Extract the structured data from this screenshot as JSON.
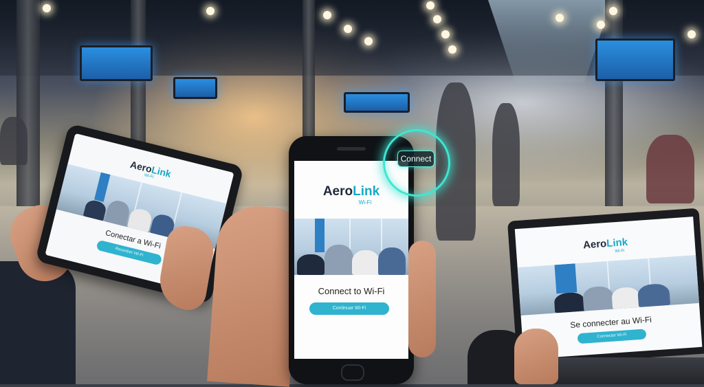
{
  "scene": {
    "setting": "airport-terminal",
    "colors": {
      "accent": "#17a9c6",
      "button": "#2fb3cf",
      "glow": "#3fe6d2",
      "brand_dark": "#1e2b3a"
    }
  },
  "overlay": {
    "connect_label": "Connect"
  },
  "tablet": {
    "brand_main": "Aero",
    "brand_accent": "Link",
    "brand_sub": "Wi-Fi",
    "cta_text": "Conectar a Wi-Fi",
    "button_label": "Recenber Wi-Fi"
  },
  "phone": {
    "brand_main": "Aero",
    "brand_accent": "Link",
    "brand_sub": "Wi-Fi",
    "cta_text": "Connect to Wi-Fi",
    "button_label": "Continuar Wi-Fi"
  },
  "laptop": {
    "brand_main": "Aero",
    "brand_accent": "Link",
    "brand_sub": "Wi-Fi",
    "cta_text": "Se connecter au Wi-Fi",
    "button_label": "Connecter Wi-Fi"
  }
}
